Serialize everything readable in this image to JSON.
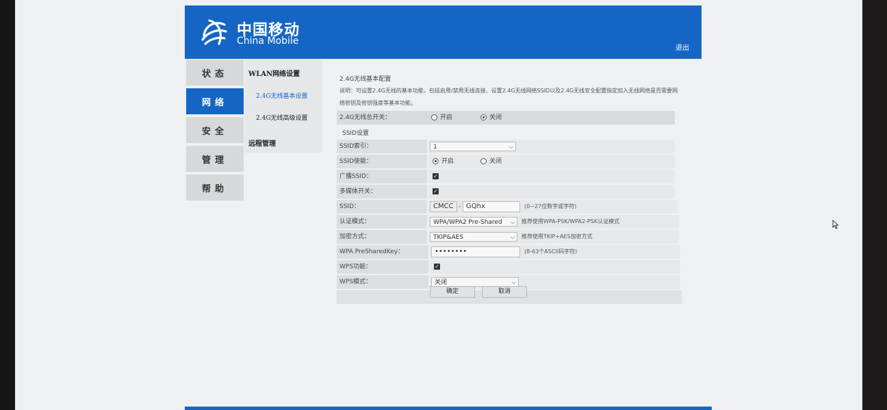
{
  "brand": {
    "cn": "中国移动",
    "en": "China Mobile",
    "logout": "退出"
  },
  "colors": {
    "brand_blue": "#1566c4",
    "page_bg": "#eef0f2"
  },
  "main_nav": [
    {
      "label": "状态",
      "active": false
    },
    {
      "label": "网络",
      "active": true
    },
    {
      "label": "安全",
      "active": false
    },
    {
      "label": "管理",
      "active": false
    },
    {
      "label": "帮助",
      "active": false
    }
  ],
  "sub_nav": {
    "group": "WLAN网络设置",
    "items": [
      "2.4G无线基本设置",
      "2.4G无线高级设置"
    ],
    "group2": "远程管理"
  },
  "content": {
    "title": "2.4G无线基本配置",
    "desc": "说明：可设置2.4G无线的基本功能，包括启用/禁用无线连接、设置2.4G无线网络SSID以及2.4G无线安全配置指定加入无线网络是否需要网络密钥及密钥强度等基本功能。",
    "master_switch": {
      "label": "2.4G无线总开关：",
      "on": "开启",
      "off": "关闭",
      "selected": "off"
    },
    "ssid_section": "SSID设置",
    "ssid_index": {
      "label": "SSID索引：",
      "value": "1"
    },
    "ssid_enable": {
      "label": "SSID使能：",
      "on": "开启",
      "off": "关闭",
      "selected": "on"
    },
    "broadcast": {
      "label": "广播SSID：",
      "checked": true
    },
    "multimedia": {
      "label": "多媒体开关：",
      "checked": true
    },
    "ssid": {
      "label": "SSID：",
      "prefix": "CMCC",
      "sep": "-",
      "value": "GQhx",
      "hint": "(0~27位数字或字符)"
    },
    "auth": {
      "label": "认证模式：",
      "value": "WPA/WPA2 Pre-Shared",
      "hint": "推荐使用WPA-PSK/WPA2-PSK认证模式"
    },
    "encrypt": {
      "label": "加密方式：",
      "value": "TKIP&AES",
      "hint": "推荐使用TKIP+AES加密方式"
    },
    "psk": {
      "label": "WPA PreSharedKey：",
      "value": "••••••••",
      "hint": "(8-63个ASCII码字符)"
    },
    "wps": {
      "label": "WPS功能：",
      "checked": true
    },
    "wps_mode": {
      "label": "WPS模式：",
      "value": "关闭"
    },
    "ok": "确定",
    "cancel": "取消"
  }
}
